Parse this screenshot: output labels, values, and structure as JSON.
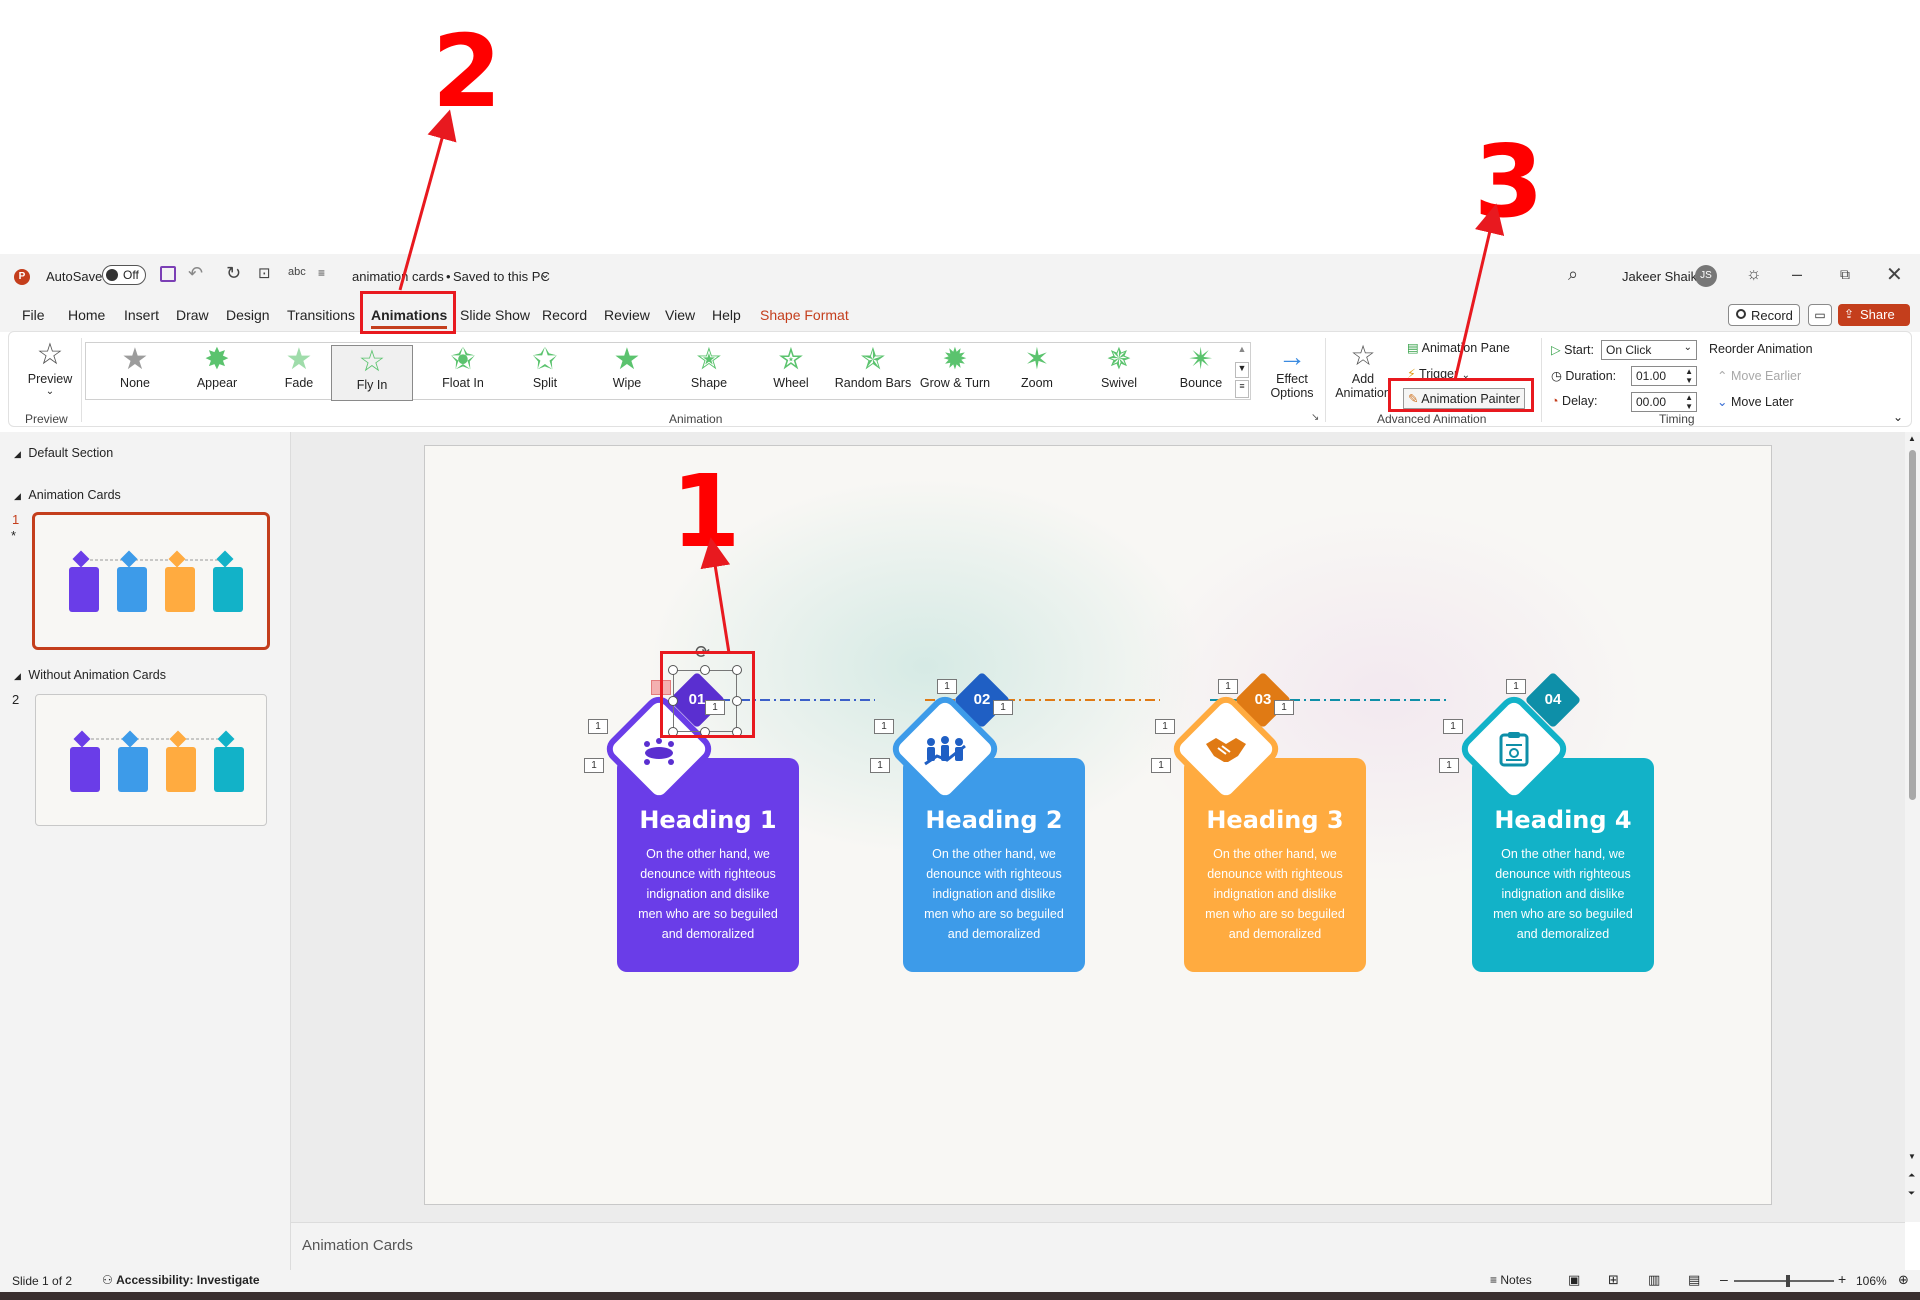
{
  "tutorial": {
    "step1": "1",
    "step2": "2",
    "step3": "3"
  },
  "titlebar": {
    "autosave_label": "AutoSave",
    "autosave_state": "Off",
    "doc_title": "animation cards",
    "doc_status": "Saved to this PC",
    "user_name": "Jakeer Shaik",
    "user_initials": "JS"
  },
  "tabs": [
    "File",
    "Home",
    "Insert",
    "Draw",
    "Design",
    "Transitions",
    "Animations",
    "Slide Show",
    "Record",
    "Review",
    "View",
    "Help",
    "Shape Format"
  ],
  "tabs_right": {
    "record": "Record",
    "share": "Share"
  },
  "ribbon": {
    "preview_label": "Preview",
    "preview_group": "Preview",
    "animation_group": "Animation",
    "animations": [
      "None",
      "Appear",
      "Fade",
      "Fly In",
      "Float In",
      "Split",
      "Wipe",
      "Shape",
      "Wheel",
      "Random Bars",
      "Grow & Turn",
      "Zoom",
      "Swivel",
      "Bounce"
    ],
    "effect_options": [
      "Effect",
      "Options"
    ],
    "add_animation": [
      "Add",
      "Animation"
    ],
    "animation_pane": "Animation Pane",
    "trigger": "Trigger",
    "animation_painter": "Animation Painter",
    "advanced_group": "Advanced Animation",
    "start_label": "Start:",
    "start_value": "On Click",
    "duration_label": "Duration:",
    "duration_value": "01.00",
    "delay_label": "Delay:",
    "delay_value": "00.00",
    "reorder_title": "Reorder Animation",
    "move_earlier": "Move Earlier",
    "move_later": "Move Later",
    "timing_group": "Timing"
  },
  "leftpane": {
    "section1": "Default Section",
    "section2": "Animation Cards",
    "section3": "Without Animation Cards",
    "slide1_num": "1",
    "slide1_star": "*",
    "slide2_num": "2"
  },
  "cards": [
    {
      "number": "01",
      "heading": "Heading 1",
      "body": "On the other hand, we denounce with righteous indignation and dislike men who are so beguiled and demoralized",
      "color": "#6a3de8",
      "badge_color": "#5a2fd0"
    },
    {
      "number": "02",
      "heading": "Heading 2",
      "body": "On the other hand, we denounce with righteous indignation and dislike men who are so beguiled and demoralized",
      "color": "#3d9be9",
      "badge_color": "#1f5fc4"
    },
    {
      "number": "03",
      "heading": "Heading 3",
      "body": "On the other hand, we denounce with righteous indignation and dislike men who are so beguiled and demoralized",
      "color": "#ffab40",
      "badge_color": "#e07a14"
    },
    {
      "number": "04",
      "heading": "Heading 4",
      "body": "On the other hand, we denounce with righteous indignation and dislike men who are so beguiled and demoralized",
      "color": "#12b2c8",
      "badge_color": "#0e8fa8"
    }
  ],
  "anim_tag": "1",
  "notes_text": "Animation Cards",
  "status": {
    "slide_info": "Slide 1 of 2",
    "accessibility": "Accessibility: Investigate",
    "notes": "Notes",
    "zoom": "106%"
  }
}
